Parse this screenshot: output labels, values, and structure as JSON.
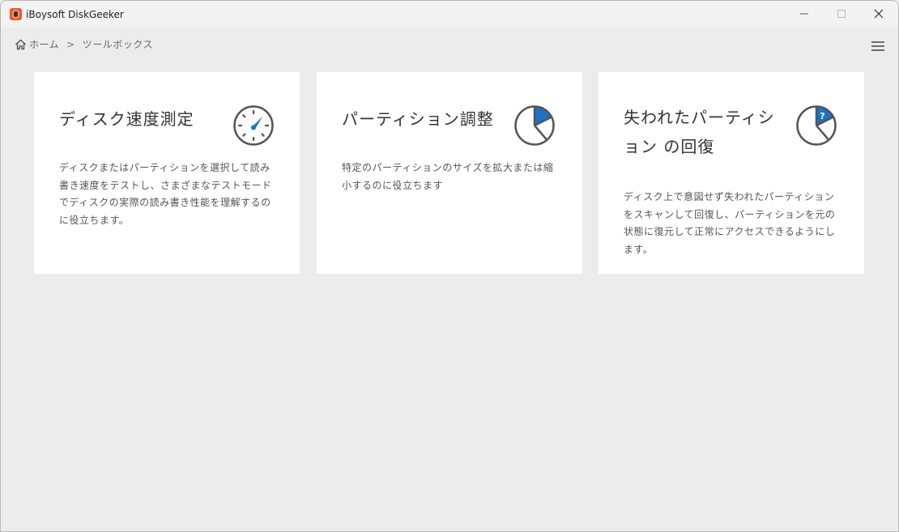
{
  "window": {
    "title": "iBoysoft DiskGeeker"
  },
  "breadcrumb": {
    "home": "ホーム",
    "separator": ">",
    "current": "ツールボックス"
  },
  "cards": [
    {
      "title": "ディスク速度測定",
      "description": "ディスクまたはパーティションを選択して読み書き速度をテストし、さまざまなテストモードでディスクの実際の読み書き性能を理解するのに役立ちます。",
      "icon": "speedometer-icon"
    },
    {
      "title": "パーティション調整",
      "description": "特定のパーティションのサイズを拡大または縮小するのに役立ちます",
      "icon": "pie-chart-icon"
    },
    {
      "title": "失われたパーティション の回復",
      "description": "ディスク上で意図せず失われたパーティションをスキャンして回復し、パーティションを元の状態に復元して正常にアクセスできるようにします。",
      "icon": "pie-question-icon"
    }
  ],
  "colors": {
    "accent": "#1a73c8",
    "background": "#ececec",
    "card": "#ffffff",
    "icon_stroke": "#555555"
  }
}
